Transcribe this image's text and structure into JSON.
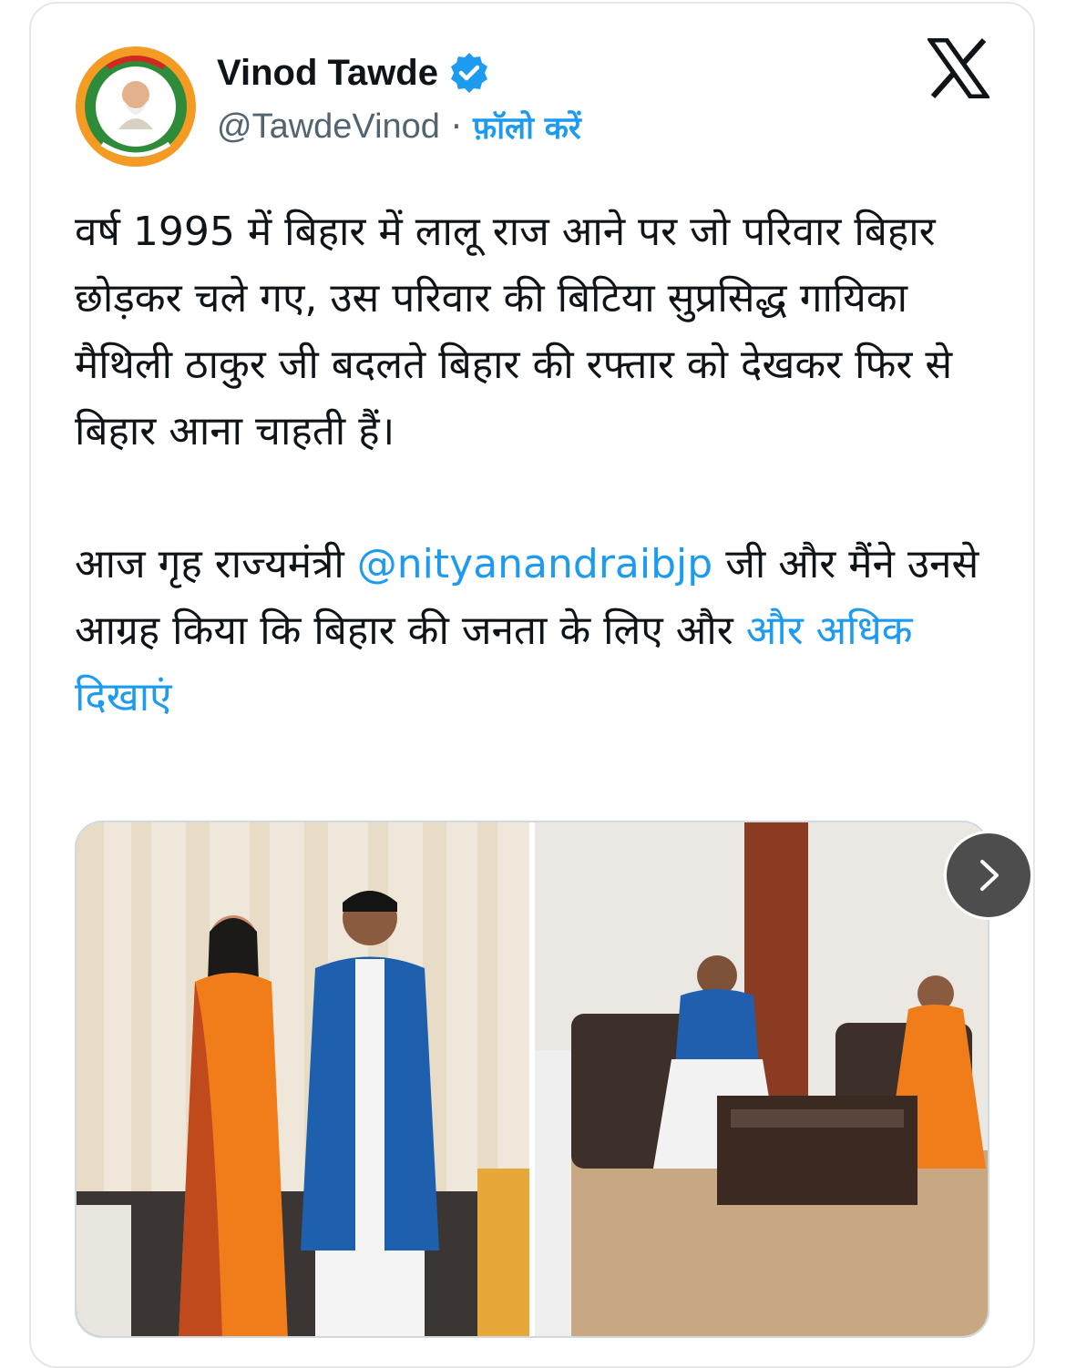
{
  "author": {
    "name": "Vinod Tawde",
    "handle": "@TawdeVinod",
    "separator": "·",
    "follow_label": "फ़ॉलो करें",
    "verified_icon": "verified-badge-icon",
    "avatar_icon": "profile-logo-icon"
  },
  "platform_icon": "x-logo-icon",
  "tweet": {
    "paragraph1": "वर्ष 1995 में बिहार में लालू राज आने पर जो परिवार बिहार छोड़कर चले गए, उस परिवार की बिटिया सुप्रसिद्ध गायिका मैथिली ठाकुर जी बदलते बिहार की रफ्तार को देखकर फिर से बिहार आना चाहती हैं।",
    "p2_before_mention": "आज गृह राज्यमंत्री ",
    "mention": "@nityanandraibjp",
    "p2_after_mention": " जी और मैंने उनसे आग्रह किया कि बिहार की जनता के लिए और ",
    "show_more": "और अधिक दिखाएं"
  },
  "media": {
    "photos": [
      {
        "name": "photo-standing-group"
      },
      {
        "name": "photo-sofa-meeting"
      }
    ],
    "next_icon": "chevron-right-icon"
  },
  "colors": {
    "accent": "#1d9bf0",
    "text": "#0f1419",
    "muted": "#536471",
    "verified": "#1d9bf0",
    "saffron": "#f07d1a"
  }
}
